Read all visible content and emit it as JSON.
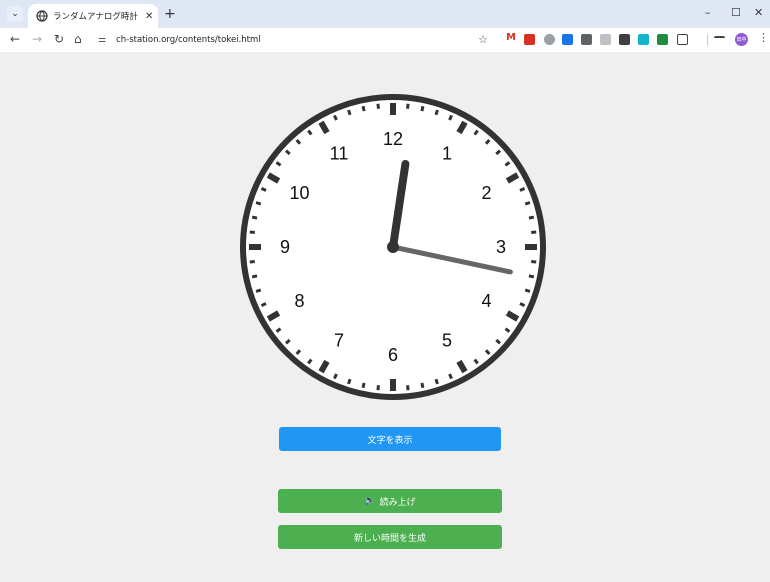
{
  "browser": {
    "tab_title": "ランダムアナログ時計（中国語表示",
    "url": "ch-station.org/contents/tokei.html",
    "profile_initials": "田中"
  },
  "clock": {
    "numbers": [
      "12",
      "1",
      "2",
      "3",
      "4",
      "5",
      "6",
      "7",
      "8",
      "9",
      "10",
      "11"
    ],
    "time": {
      "hour": 12,
      "minute": 17
    }
  },
  "buttons": {
    "show_text": "文字を表示",
    "read_aloud": "読み上げ",
    "new_time": "新しい時間を生成"
  }
}
